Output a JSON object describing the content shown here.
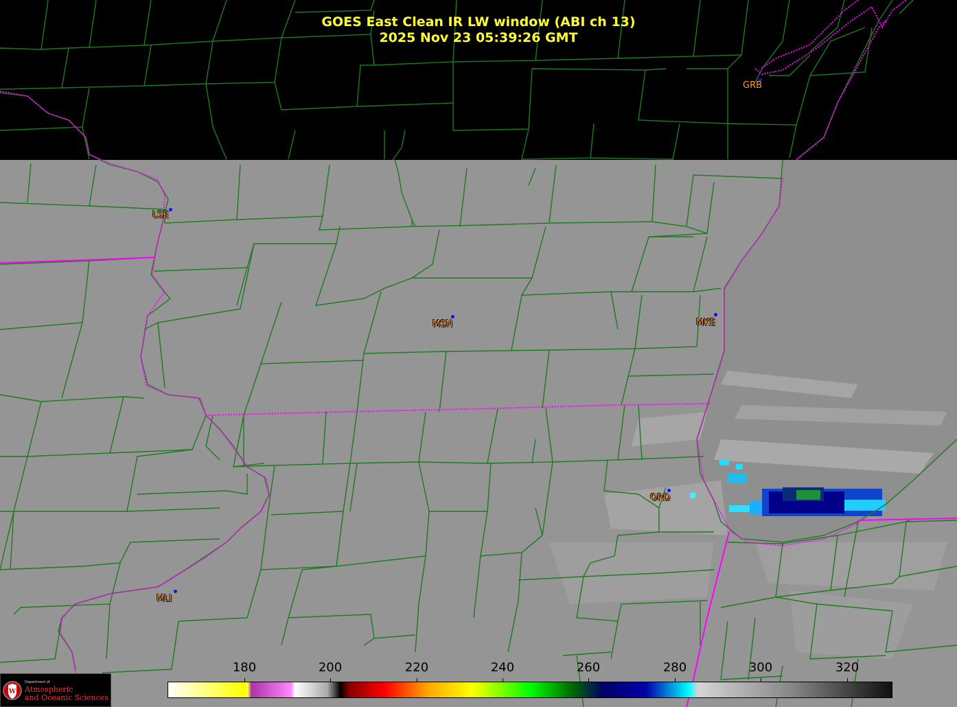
{
  "title": {
    "line1": "GOES East Clean IR LW window (ABI ch 13)",
    "line2": "2025 Nov 23  05:39:26 GMT"
  },
  "stations": [
    {
      "id": "GRB",
      "style": "plain"
    },
    {
      "id": "LSE",
      "style": "outline"
    },
    {
      "id": "MSN",
      "style": "outline"
    },
    {
      "id": "MKE",
      "style": "outline"
    },
    {
      "id": "ORD",
      "style": "outline"
    },
    {
      "id": "MLI",
      "style": "outline"
    }
  ],
  "colorbar": {
    "ticks": [
      "180",
      "200",
      "220",
      "240",
      "260",
      "280",
      "300",
      "320"
    ],
    "stops": [
      "#ffffff",
      "#ffff00",
      "#ffff33",
      "#aa33aa",
      "#ff88ff",
      "#ffffff",
      "#aaaaaa",
      "#000000",
      "#880000",
      "#ff0000",
      "#ffaa00",
      "#ffff00",
      "#00ff00",
      "#006600",
      "#000066",
      "#0000aa",
      "#00ffff",
      "#d6d6d6",
      "#888888",
      "#101010"
    ]
  },
  "colors": {
    "background_gray": "#959595",
    "dark_area": "#000000",
    "county_lines": "#1e7a1e",
    "state_lines": "#ff00ff",
    "title": "#ffff33",
    "station_label": "#ff9922",
    "station_dot": "#1010ff"
  },
  "logo": {
    "dept": "Department of",
    "line1": "Atmospheric",
    "line2": "and Oceanic Sciences"
  }
}
